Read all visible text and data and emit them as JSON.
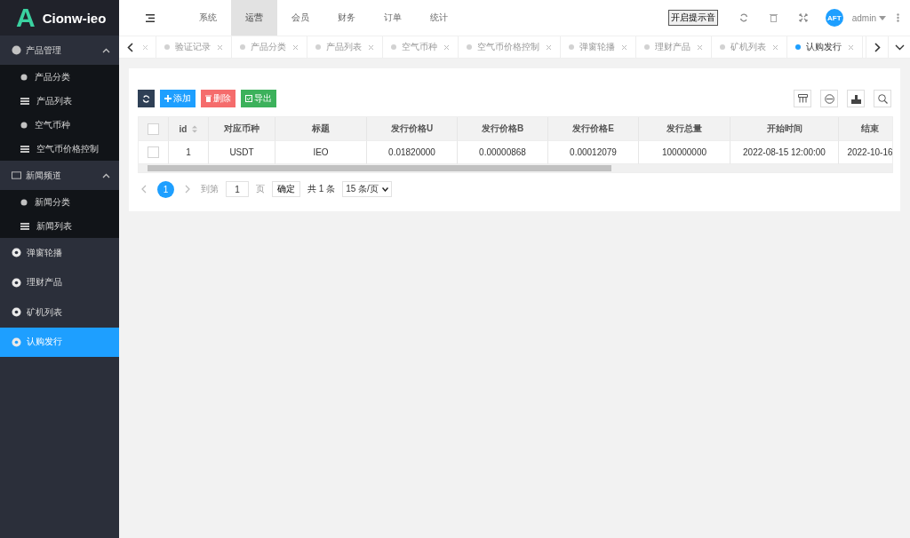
{
  "logo": {
    "letter": "A",
    "name": "Cionw-ieo"
  },
  "top_nav": [
    {
      "label": "系统",
      "selected": false
    },
    {
      "label": "运营",
      "selected": true
    },
    {
      "label": "会员",
      "selected": false
    },
    {
      "label": "财务",
      "selected": false
    },
    {
      "label": "订单",
      "selected": false
    },
    {
      "label": "统计",
      "selected": false
    }
  ],
  "header": {
    "sound_button": "开启提示音",
    "avatar": "AFT",
    "user": "admin"
  },
  "sidebar": [
    {
      "kind": "group",
      "label": "产品管理",
      "expanded": true,
      "children": [
        {
          "label": "产品分类",
          "selected": false
        },
        {
          "label": "产品列表",
          "selected": false
        },
        {
          "label": "空气币种",
          "selected": false
        },
        {
          "label": "空气币价格控制",
          "selected": false
        }
      ]
    },
    {
      "kind": "group",
      "label": "新闻频道",
      "expanded": true,
      "children": [
        {
          "label": "新闻分类",
          "selected": false
        },
        {
          "label": "新闻列表",
          "selected": false
        }
      ]
    },
    {
      "kind": "item",
      "label": "弹窗轮播",
      "selected": false
    },
    {
      "kind": "item",
      "label": "理财产品",
      "selected": false
    },
    {
      "kind": "item",
      "label": "矿机列表",
      "selected": false
    },
    {
      "kind": "item",
      "label": "认购发行",
      "selected": true
    }
  ],
  "tabs": [
    {
      "label": "验证记录",
      "selected": false
    },
    {
      "label": "产品分类",
      "selected": false
    },
    {
      "label": "产品列表",
      "selected": false
    },
    {
      "label": "空气币种",
      "selected": false
    },
    {
      "label": "空气币价格控制",
      "selected": false
    },
    {
      "label": "弹窗轮播",
      "selected": false
    },
    {
      "label": "理财产品",
      "selected": false
    },
    {
      "label": "矿机列表",
      "selected": false
    },
    {
      "label": "认购发行",
      "selected": true
    }
  ],
  "toolbar": {
    "add": "添加",
    "delete": "删除",
    "export": "导出"
  },
  "table": {
    "all_checked": false,
    "columns": [
      "id",
      "对应币种",
      "标题",
      "发行价格U",
      "发行价格B",
      "发行价格E",
      "发行总量",
      "开始时间",
      "结束"
    ],
    "rows": [
      {
        "checked": false,
        "cells": [
          "1",
          "USDT",
          "IEO",
          "0.01820000",
          "0.00000868",
          "0.00012079",
          "100000000",
          "2022-08-15 12:00:00",
          "2022-10-16"
        ]
      }
    ]
  },
  "pagination": {
    "current": "1",
    "goto_label": "到第",
    "page_input": "1",
    "page_unit": "页",
    "confirm": "确定",
    "total": "共 1 条",
    "page_size": "15 条/页"
  }
}
